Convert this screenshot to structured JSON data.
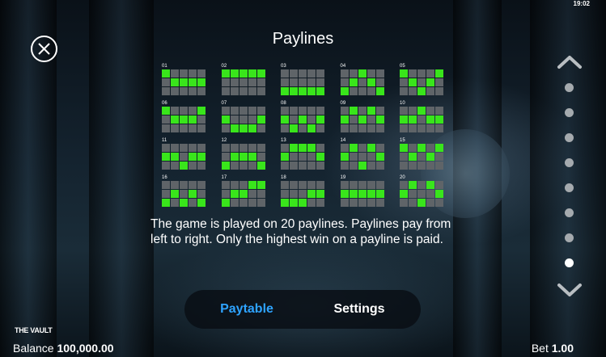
{
  "status_time": "19:02",
  "title": "Paylines",
  "paylines": [
    {
      "num": "01",
      "rows": [
        0,
        1,
        1,
        1,
        1
      ]
    },
    {
      "num": "02",
      "rows": [
        0,
        0,
        0,
        0,
        0
      ]
    },
    {
      "num": "03",
      "rows": [
        2,
        2,
        2,
        2,
        2
      ]
    },
    {
      "num": "04",
      "rows": [
        2,
        1,
        0,
        1,
        2
      ]
    },
    {
      "num": "05",
      "rows": [
        0,
        1,
        2,
        1,
        0
      ]
    },
    {
      "num": "06",
      "rows": [
        0,
        1,
        1,
        1,
        0
      ]
    },
    {
      "num": "07",
      "rows": [
        1,
        2,
        2,
        2,
        1
      ]
    },
    {
      "num": "08",
      "rows": [
        1,
        2,
        1,
        2,
        1
      ]
    },
    {
      "num": "09",
      "rows": [
        1,
        0,
        1,
        0,
        1
      ]
    },
    {
      "num": "10",
      "rows": [
        1,
        1,
        0,
        1,
        1
      ]
    },
    {
      "num": "11",
      "rows": [
        1,
        1,
        2,
        1,
        1
      ]
    },
    {
      "num": "12",
      "rows": [
        2,
        1,
        1,
        1,
        2
      ]
    },
    {
      "num": "13",
      "rows": [
        1,
        0,
        0,
        0,
        1
      ]
    },
    {
      "num": "14",
      "rows": [
        1,
        0,
        2,
        0,
        1
      ]
    },
    {
      "num": "15",
      "rows": [
        0,
        1,
        0,
        1,
        0
      ]
    },
    {
      "num": "16",
      "rows": [
        2,
        1,
        2,
        1,
        2
      ]
    },
    {
      "num": "17",
      "rows": [
        2,
        1,
        1,
        0,
        0
      ]
    },
    {
      "num": "18",
      "rows": [
        2,
        2,
        2,
        1,
        1
      ]
    },
    {
      "num": "19",
      "rows": [
        1,
        1,
        1,
        1,
        1
      ]
    },
    {
      "num": "20",
      "rows": [
        1,
        0,
        2,
        0,
        1
      ]
    }
  ],
  "description": "The game is played on 20 paylines. Paylines pay from left to right. Only the highest win on a payline is paid.",
  "pagination": {
    "pages": 8,
    "active_page": 8
  },
  "tabs": {
    "paytable": "Paytable",
    "settings": "Settings",
    "active": "paytable"
  },
  "logo_text": "THE VAULT",
  "balance": {
    "label": "Balance",
    "value": "100,000.00"
  },
  "bet": {
    "label": "Bet",
    "value": "1.00"
  },
  "colors": {
    "payline_on": "#39e51b",
    "payline_off": "#5f6468",
    "active_tab": "#2ea3ff"
  },
  "icons": {
    "close": "close-circle-icon",
    "up": "chevron-up-icon",
    "down": "chevron-down-icon"
  }
}
